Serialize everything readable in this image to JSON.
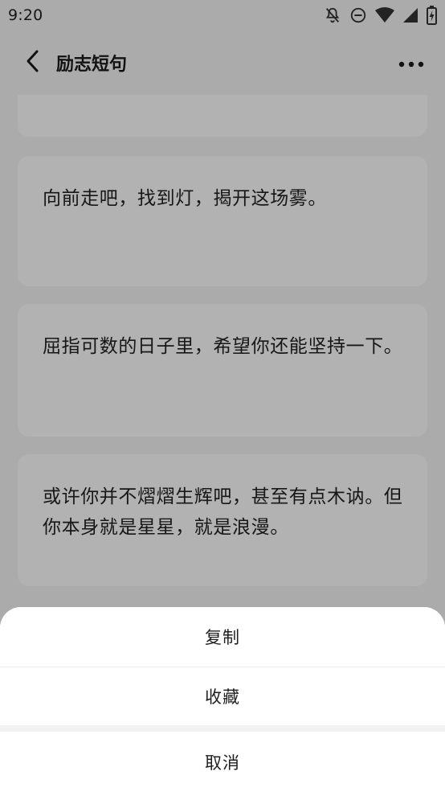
{
  "status_bar": {
    "time": "9:20",
    "icons": [
      "notifications-off-icon",
      "do-not-disturb-icon",
      "wifi-icon",
      "cellular-signal-icon",
      "battery-charging-icon"
    ]
  },
  "app_bar": {
    "back_icon": "chevron-left-icon",
    "title": "励志短句",
    "more_icon": "more-horizontal-icon"
  },
  "quotes": [
    {
      "text": ""
    },
    {
      "text": "向前走吧，找到灯，揭开这场雾。"
    },
    {
      "text": "屈指可数的日子里，希望你还能坚持一下。"
    },
    {
      "text": "或许你并不熠熠生辉吧，甚至有点木讷。但你本身就是星星，就是浪漫。"
    }
  ],
  "action_sheet": {
    "items": [
      {
        "label": "复制"
      },
      {
        "label": "收藏"
      }
    ],
    "cancel_label": "取消"
  },
  "colors": {
    "page_background": "#f5f5f5",
    "card_background": "#ffffff",
    "scrim": "rgba(0,0,0,0.30)",
    "sheet_background": "#ffffff"
  }
}
